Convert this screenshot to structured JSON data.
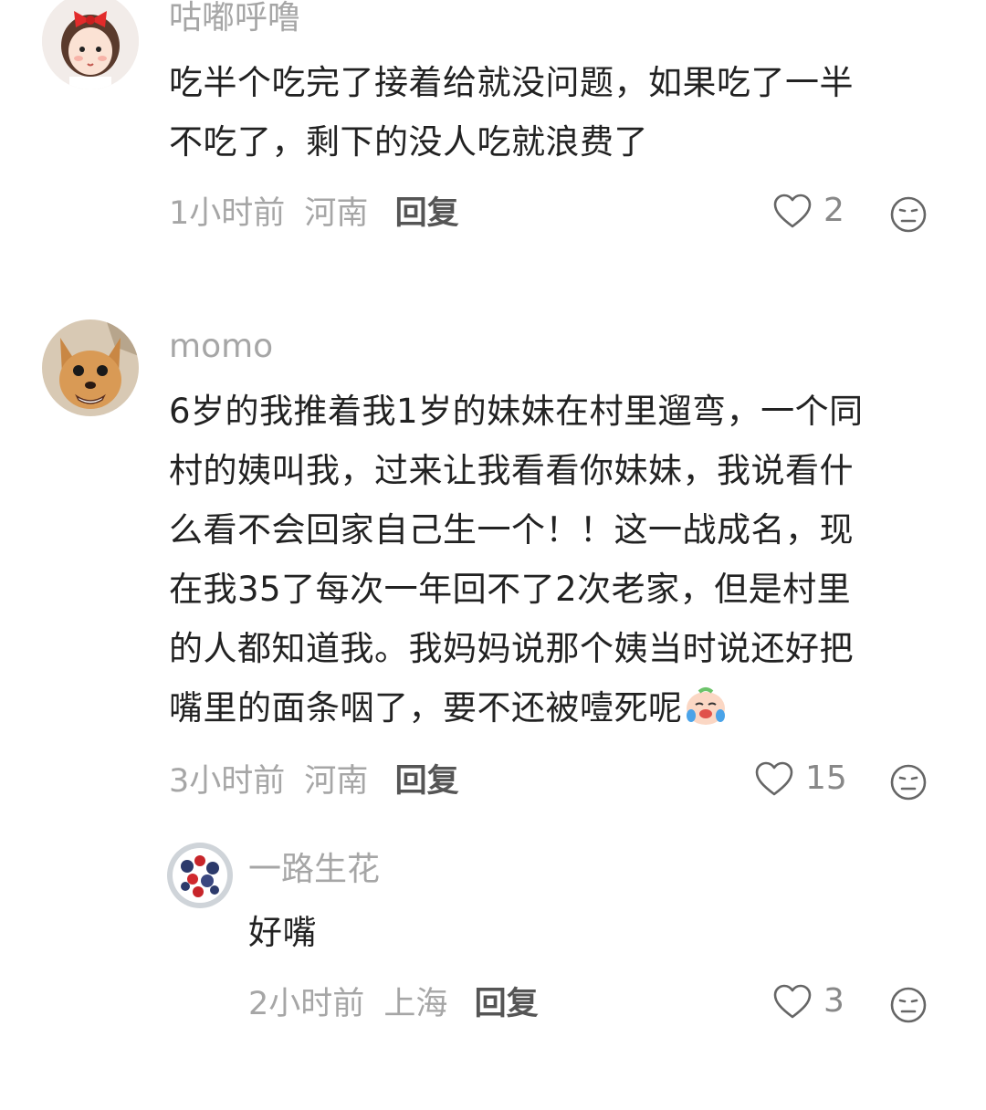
{
  "comments": [
    {
      "username": "咕嘟呼噜",
      "text": "吃半个吃完了接着给就没问题，如果吃了一半\n不吃了，剩下的没人吃就浪费了",
      "time": "1小时前",
      "location": "河南",
      "reply_label": "回复",
      "likes": "2",
      "avatar_icon": "girl-with-red-bow-avatar"
    },
    {
      "username": "momo",
      "text": "6岁的我推着我1岁的妹妹在村里遛弯，一个同\n村的姨叫我，过来让我看看你妹妹，我说看什\n么看不会回家自己生一个！！这一战成名，现\n在我35了每次一年回不了2次老家，但是村里\n的人都知道我。我妈妈说那个姨当时说还好把\n嘴里的面条咽了，要不还被噎死呢",
      "time": "3小时前",
      "location": "河南",
      "reply_label": "回复",
      "likes": "15",
      "avatar_icon": "chihuahua-dog-avatar",
      "trailing_emoji": "crying-laughing-emoji"
    }
  ],
  "replies": [
    {
      "username": "一路生花",
      "text": "好嘴",
      "time": "2小时前",
      "location": "上海",
      "reply_label": "回复",
      "likes": "3",
      "avatar_icon": "berries-bowl-avatar"
    }
  ],
  "icons": {
    "like": "heart-outline-icon",
    "dislike": "neutral-face-icon"
  },
  "colors": {
    "muted_text": "#a6a6a6",
    "body_text": "#222222",
    "reply_label": "#555555"
  }
}
